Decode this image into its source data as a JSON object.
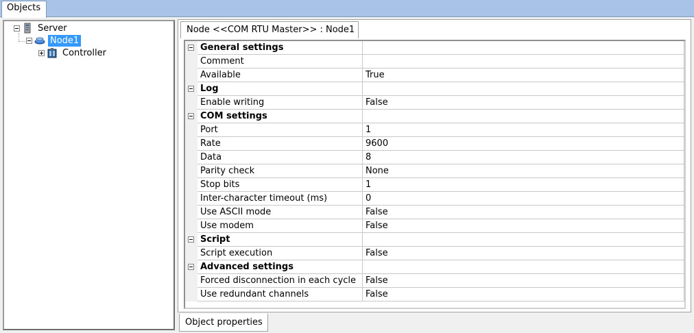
{
  "window": {
    "objects_tab": "Objects"
  },
  "tree": {
    "server": "Server",
    "node1": "Node1",
    "controller": "Controller"
  },
  "editor": {
    "header_tab": "Node <<COM RTU Master>> : Node1"
  },
  "grid": {
    "rows": [
      {
        "type": "category",
        "name": "General settings",
        "value": ""
      },
      {
        "type": "prop",
        "name": "Comment",
        "value": ""
      },
      {
        "type": "prop",
        "name": "Available",
        "value": "True"
      },
      {
        "type": "category",
        "name": "Log",
        "value": ""
      },
      {
        "type": "prop",
        "name": "Enable writing",
        "value": "False"
      },
      {
        "type": "category",
        "name": "COM settings",
        "value": ""
      },
      {
        "type": "prop",
        "name": "Port",
        "value": "1"
      },
      {
        "type": "prop",
        "name": "Rate",
        "value": "9600"
      },
      {
        "type": "prop",
        "name": "Data",
        "value": "8"
      },
      {
        "type": "prop",
        "name": "Parity check",
        "value": "None"
      },
      {
        "type": "prop",
        "name": "Stop bits",
        "value": "1"
      },
      {
        "type": "prop",
        "name": "Inter-character timeout (ms)",
        "value": "0"
      },
      {
        "type": "prop",
        "name": "Use ASCII mode",
        "value": "False"
      },
      {
        "type": "prop",
        "name": "Use modem",
        "value": "False"
      },
      {
        "type": "category",
        "name": "Script",
        "value": ""
      },
      {
        "type": "prop",
        "name": "Script execution",
        "value": "False"
      },
      {
        "type": "category",
        "name": "Advanced settings",
        "value": ""
      },
      {
        "type": "prop",
        "name": "Forced disconnection in each cycle",
        "value": "False"
      },
      {
        "type": "prop",
        "name": "Use redundant channels",
        "value": "False"
      }
    ]
  },
  "bottom": {
    "properties_tab": "Object properties"
  }
}
